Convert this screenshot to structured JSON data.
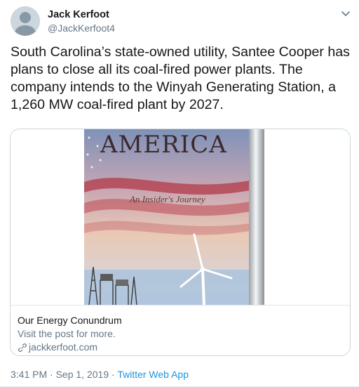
{
  "author": {
    "name": "Jack Kerfoot",
    "handle": "@JackKerfoot4",
    "avatar_icon": "default-avatar-icon"
  },
  "tweet": {
    "text": "South Carolina’s state-owned utility, Santee Cooper has plans to close all its coal-fired power plants. The company intends to the Winyah Generating Station, a 1,260 MW coal-fired plant by 2027."
  },
  "card": {
    "book_title": "AMERICA",
    "book_subtitle": "An Insider's Journey",
    "title": "Our Energy Conundrum",
    "description": "Visit the post for more.",
    "domain": "jackkerfoot.com"
  },
  "footer": {
    "time": "3:41 PM",
    "separator_1": " · ",
    "date": "Sep 1, 2019",
    "separator_2": " · ",
    "source": "Twitter Web App"
  },
  "colors": {
    "text_primary": "#14171a",
    "text_secondary": "#657786",
    "link": "#1b95e0",
    "border": "#ccd6dd"
  },
  "icons": {
    "more": "chevron-down-icon",
    "link": "link-icon"
  }
}
